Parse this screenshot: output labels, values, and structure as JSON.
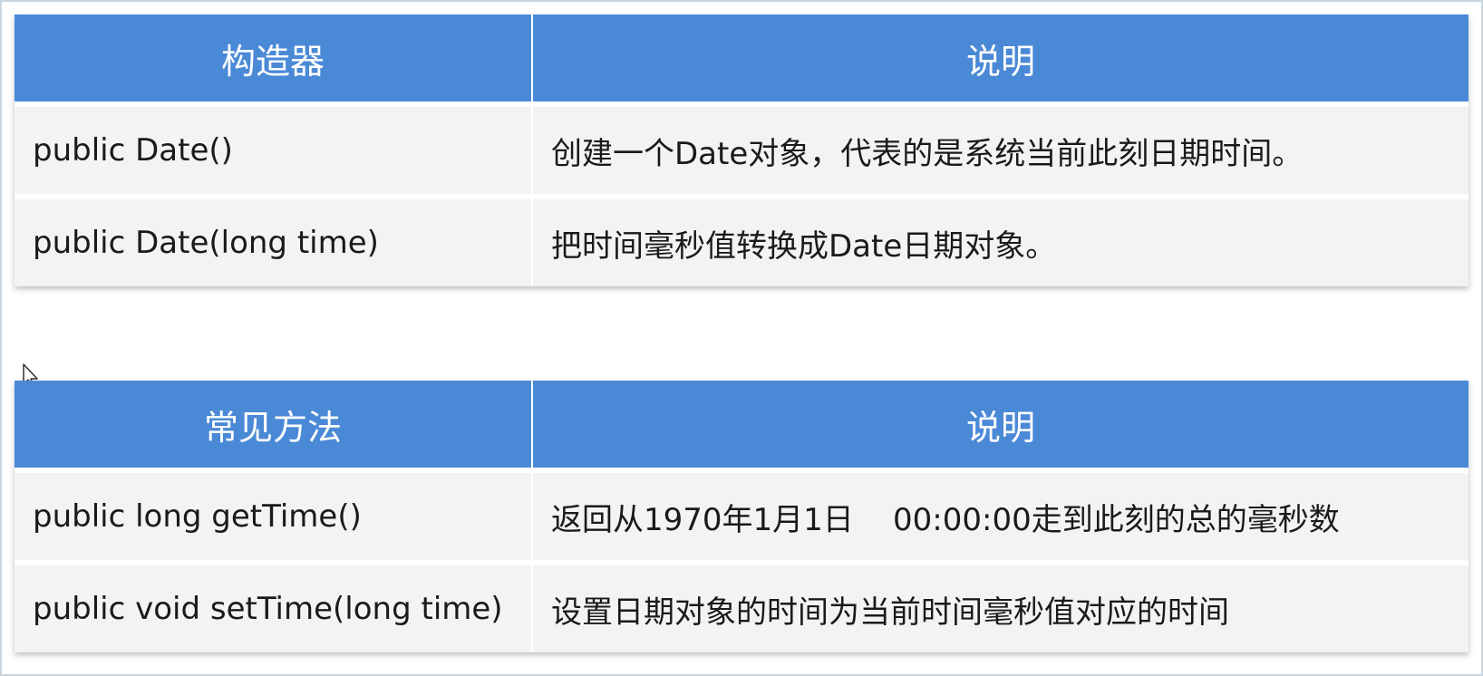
{
  "constructors_table": {
    "header": [
      "构造器",
      "说明"
    ],
    "rows": [
      [
        "public Date()",
        "创建一个Date对象，代表的是系统当前此刻日期时间。"
      ],
      [
        "public Date(long time)",
        "把时间毫秒值转换成Date日期对象。"
      ]
    ]
  },
  "methods_table": {
    "header": [
      "常见方法",
      "说明"
    ],
    "rows": [
      [
        "public long getTime()",
        "返回从1970年1月1日    00:00:00走到此刻的总的毫秒数"
      ],
      [
        "public void setTime(long time)",
        "设置日期对象的时间为当前时间毫秒值对应的时间"
      ]
    ]
  },
  "colors": {
    "header_bg": "#4a89d6",
    "row_bg": "#f3f3f3"
  },
  "icons": {
    "cursor": "mouse-pointer-icon"
  }
}
